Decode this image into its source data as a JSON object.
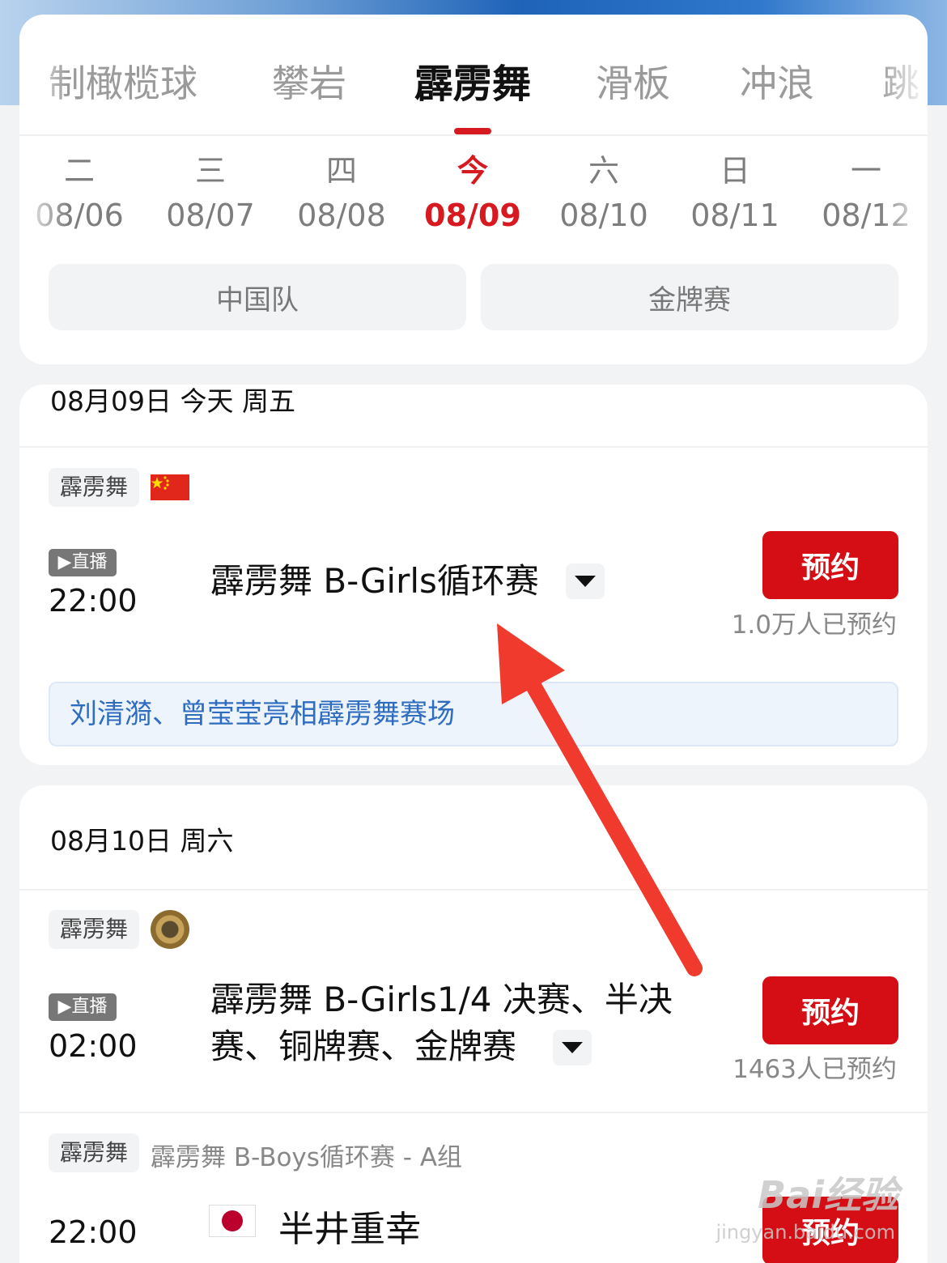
{
  "sport_tabs": [
    "制橄榄球",
    "攀岩",
    "霹雳舞",
    "滑板",
    "冲浪",
    "跳"
  ],
  "dates": [
    {
      "weekday": "二",
      "date": "08/06"
    },
    {
      "weekday": "三",
      "date": "08/07"
    },
    {
      "weekday": "四",
      "date": "08/08"
    },
    {
      "weekday": "今",
      "date": "08/09"
    },
    {
      "weekday": "六",
      "date": "08/10"
    },
    {
      "weekday": "日",
      "date": "08/11"
    },
    {
      "weekday": "一",
      "date": "08/12"
    }
  ],
  "filters": {
    "china_team": "中国队",
    "gold_medal": "金牌赛"
  },
  "section1": {
    "date_label": "08月09日 今天 周五",
    "event": {
      "tag": "霹雳舞",
      "live": "▶直播",
      "time": "22:00",
      "title": "霹雳舞 B-Girls循环赛",
      "reserve": "预约",
      "reserve_count": "1.0万人已预约",
      "news": "刘清漪、曾莹莹亮相霹雳舞赛场"
    }
  },
  "section2": {
    "date_label": "08月10日 周六",
    "event1": {
      "tag": "霹雳舞",
      "live": "▶直播",
      "time": "02:00",
      "title_line1": "霹雳舞 B-Girls1/4 决赛、半决",
      "title_line2": "赛、铜牌赛、金牌赛",
      "reserve": "预约",
      "reserve_count": "1463人已预约"
    },
    "event2": {
      "tag": "霹雳舞",
      "subtitle": "霹雳舞 B-Boys循环赛 - A组",
      "time": "22:00",
      "athlete": "半井重幸",
      "reserve": "预约"
    }
  },
  "watermark": {
    "brand": "Bai经验",
    "url": "jingyan.baidu.com"
  },
  "colors": {
    "accent": "#d71920",
    "button": "#d40e14",
    "link": "#2f6dc0",
    "arrow": "#f03a2e"
  }
}
